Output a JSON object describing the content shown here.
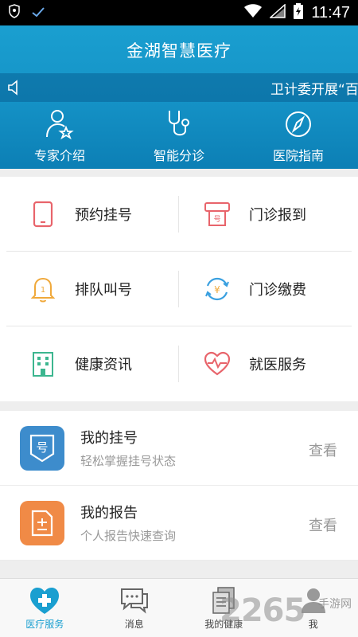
{
  "status_bar": {
    "time": "11:47"
  },
  "header": {
    "title": "金湖智慧医疗",
    "notice": "卫计委开展“百",
    "quick_links": [
      {
        "label": "专家介绍",
        "icon": "doctor-star-icon"
      },
      {
        "label": "智能分诊",
        "icon": "stethoscope-icon"
      },
      {
        "label": "医院指南",
        "icon": "compass-icon"
      }
    ]
  },
  "grid": {
    "items": [
      {
        "label": "预约挂号",
        "icon": "phone-icon",
        "color": "#e8646b"
      },
      {
        "label": "门诊报到",
        "icon": "ticket-machine-icon",
        "color": "#e8646b"
      },
      {
        "label": "排队叫号",
        "icon": "bell-icon",
        "color": "#f0a93b"
      },
      {
        "label": "门诊缴费",
        "icon": "yen-refresh-icon",
        "color": "#3aa0e0"
      },
      {
        "label": "健康资讯",
        "icon": "building-icon",
        "color": "#3cb68f"
      },
      {
        "label": "就医服务",
        "icon": "heart-pulse-icon",
        "color": "#e8646b"
      }
    ]
  },
  "list": {
    "items": [
      {
        "title": "我的挂号",
        "subtitle": "轻松掌握挂号状态",
        "action": "查看",
        "icon_char": "号",
        "color": "#3d8ccc"
      },
      {
        "title": "我的报告",
        "subtitle": "个人报告快速查询",
        "action": "查看",
        "icon_char": "",
        "color": "#f08a46"
      }
    ]
  },
  "tabbar": {
    "tabs": [
      {
        "label": "医疗服务",
        "icon": "medical-cross-icon",
        "active": true
      },
      {
        "label": "消息",
        "icon": "chat-bubble-icon",
        "active": false
      },
      {
        "label": "我的健康",
        "icon": "documents-icon",
        "active": false
      },
      {
        "label": "我",
        "icon": "person-icon",
        "active": false
      }
    ]
  },
  "watermark": {
    "number": "2265",
    "text": "手游网"
  }
}
